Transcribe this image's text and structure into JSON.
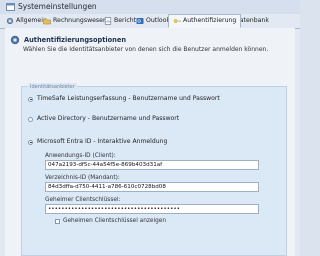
{
  "window": {
    "title": "Systemeinstellungen"
  },
  "tabs": [
    {
      "label": "Allgemein",
      "icon": "gear-icon"
    },
    {
      "label": "Rechnungswesen",
      "icon": "folder-icon"
    },
    {
      "label": "Berichte",
      "icon": "report-icon"
    },
    {
      "label": "Outlook",
      "icon": "outlook-icon"
    },
    {
      "label": "Authentifizierung",
      "icon": "key-icon",
      "active": true
    },
    {
      "label": "Datenbank",
      "icon": "database-icon"
    }
  ],
  "section": {
    "title": "Authentifizierungsoptionen",
    "description": "Wählen Sie die Identitätsanbieter von denen sich die Benutzer anmelden können."
  },
  "provider_group": {
    "label": "Identitätsanbieter",
    "options": [
      {
        "label": "TimeSafe Leistungserfassung - Benutzername und Passwort",
        "checked": true
      },
      {
        "label": "Active Directory - Benutzername und Passwort",
        "checked": false
      },
      {
        "label": "Microsoft Entra ID - Interaktive Anmeldung",
        "checked": true
      }
    ]
  },
  "entra": {
    "app_id_label": "Anwendungs-ID (Client):",
    "app_id_value": "047a2193-df5c-44a54f5e-869b403d31af",
    "tenant_id_label": "Verzeichnis-ID (Mandant):",
    "tenant_id_value": "84d3dffa-d750-4411-a786-610c0728bd08",
    "secret_label": "Geheimer Clientschlüssel:",
    "secret_value": "••••••••••••••••••••••••••••••••••••••••",
    "show_secret_label": "Geheimen Clientschlüssel anzeigen",
    "show_secret_checked": false
  }
}
